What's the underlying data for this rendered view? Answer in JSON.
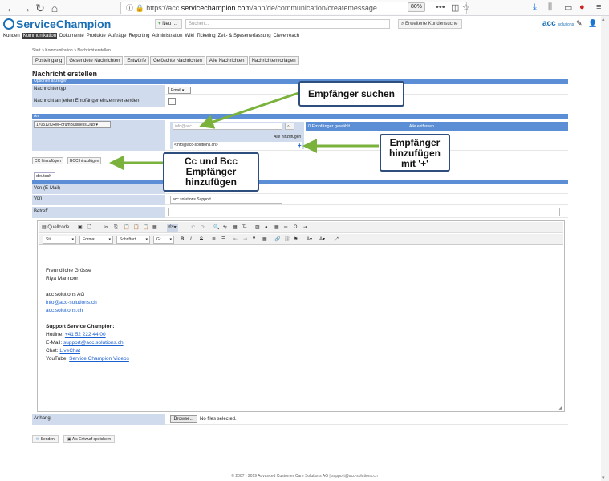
{
  "browser": {
    "url_prefix": "https://acc.",
    "url_domain": "servicechampion.com",
    "url_path": "/app/de/communication/createmessage",
    "zoom": "80%",
    "menu_dots": "•••"
  },
  "app": {
    "logo_text": "ServiceChampion",
    "new_button": "Neu ...",
    "search_placeholder": "Suchen...",
    "extended_search": "Erweiterte Kundensuche",
    "acc_logo": "acc",
    "acc_logo_small": "solutions"
  },
  "menu": [
    "Kunden",
    "Kommunikation",
    "Dokumente",
    "Produkte",
    "Aufträge",
    "Reporting",
    "Administration",
    "Wiki",
    "Ticketing",
    "Zeit- & Spesenerfassung",
    "Cleverreach"
  ],
  "menu_active": "Kommunikation",
  "breadcrumb": "Start > Kommunikation > Nachricht erstellen",
  "tabs": [
    "Posteingang",
    "Gesendete Nachrichten",
    "Entwürfe",
    "Gelöschte Nachrichten",
    "Alle Nachrichten",
    "Nachrichtenvorlagen"
  ],
  "page_title": "Nachricht erstellen",
  "options": {
    "header": "Optionen anzeigen",
    "type_label": "Nachrichtentyp",
    "type_value": "Email",
    "each_recipient_label": "Nachricht an jeden Empfänger einzeln versenden"
  },
  "to": {
    "header": "An",
    "group_select": "170512CRMForumBusinessClub",
    "search_placeholder": "info@acc",
    "add_all": "Alle hinzufügen",
    "suggestion": "<info@acc-solutions.ch>",
    "add_symbol": "+",
    "selected_count": "0 Empfänger gewählt",
    "remove_all": "Alle entfernen"
  },
  "cc_button": "CC hinzufügen",
  "bcc_button": "BCC hinzufügen",
  "lang_tab": "deutsch",
  "from_email_label": "Von (E-Mail)",
  "from_label": "Von",
  "from_value": "acc solutions Support",
  "subject_label": "Betreff",
  "editor": {
    "source": "Quellcode",
    "style": "Stil",
    "format": "Format",
    "font": "Schriftart",
    "size": "Gr...",
    "lines": {
      "greeting": "Freundliche Grüsse",
      "name": "Riya Mannoor",
      "company": "acc solutions AG",
      "email": "info@acc-solutions.ch",
      "web": "acc.solutions.ch",
      "support_title": "Support Service Champion:",
      "hotline_label": "Hotline:",
      "hotline": "+41 52 222 44 00",
      "email_label": "E-Mail:",
      "support_email": "support@acc.solutions.ch",
      "chat_label": "Chat:",
      "chat": "LiveChat",
      "youtube_label": "YouTube:",
      "youtube": "Service Champion Videos"
    }
  },
  "attachment_label": "Anhang",
  "browse_button": "Browse...",
  "no_file": "No files selected.",
  "send_button": "Senden",
  "draft_button": "Als Entwurf speichern",
  "footer": "© 2007 - 2019  Advanced Customer Care Solutions AG | support@acc-solutions.ch",
  "callouts": {
    "search": "Empfänger suchen",
    "add": "Empfänger hinzufügen mit '+'",
    "ccbcc": "Cc und Bcc Empfänger hinzufügen"
  },
  "colors": {
    "bar": "#5b8ed4",
    "label_bg": "#d0dced",
    "arrow": "#7ab23c",
    "callout_border": "#2e4f7e"
  }
}
